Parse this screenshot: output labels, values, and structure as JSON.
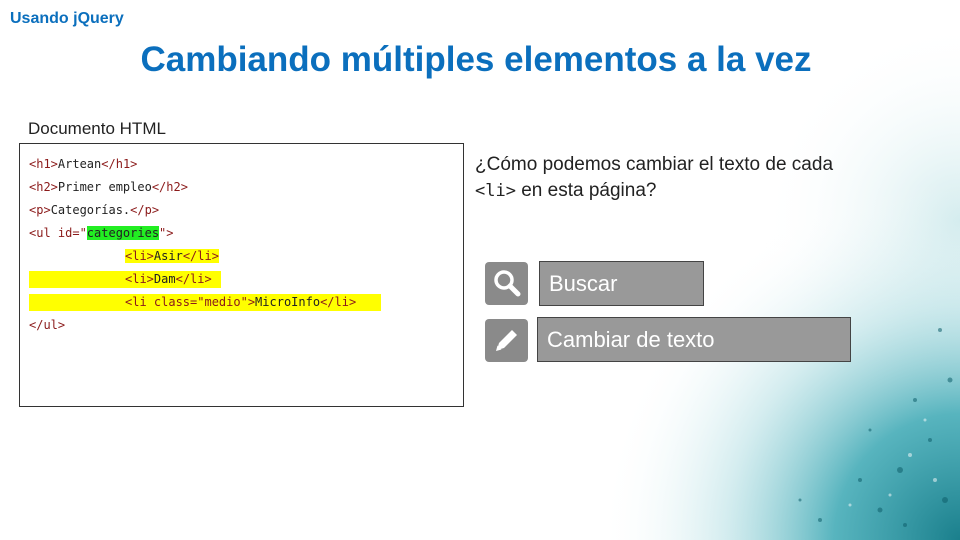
{
  "header": {
    "tag": "Usando jQuery",
    "title": "Cambiando múltiples elementos a la vez"
  },
  "document": {
    "label": "Documento HTML",
    "lines": {
      "l1": {
        "open": "<h1>",
        "text": "Artean",
        "close": "</h1>"
      },
      "l2": {
        "open": "<h2>",
        "text": "Primer empleo",
        "close": "</h2>"
      },
      "l3": {
        "open": "<p>",
        "text": "Categorías.",
        "close": "</p>"
      },
      "l4": {
        "open": "<ul id=\"",
        "id": "categories",
        "close": "\">"
      },
      "l5": {
        "open": "<li>",
        "text": "Asir",
        "close": "</li>"
      },
      "l6": {
        "open": "<li>",
        "text": "Dam",
        "close": "</li>"
      },
      "l7": {
        "open": "<li class=\"medio\">",
        "text": "MicroInfo",
        "close": "</li>"
      },
      "l8": {
        "close": "</ul>"
      }
    }
  },
  "question": {
    "part1": "¿Cómo podemos cambiar el texto de cada ",
    "code": "<li>",
    "part2": " en esta página?"
  },
  "actions": {
    "search": {
      "label": "Buscar",
      "icon": "search-icon"
    },
    "change": {
      "label": "Cambiar de texto",
      "icon": "pencil-icon"
    }
  },
  "colors": {
    "accent": "#0b6fbd",
    "highlight_yellow": "#ffff00",
    "highlight_green": "#22ee22",
    "button_gray": "#999999"
  }
}
